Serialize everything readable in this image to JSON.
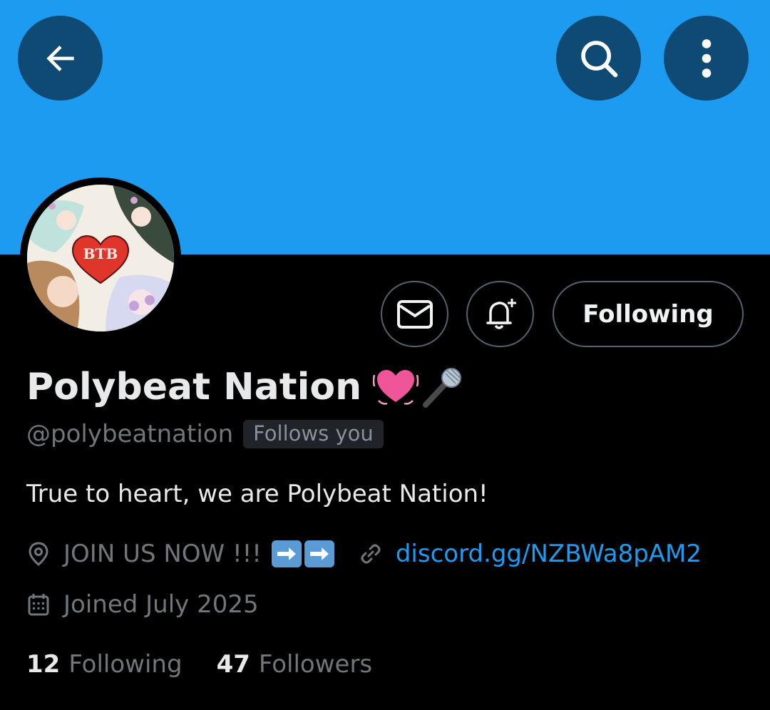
{
  "header": {
    "back_icon": "arrow-left-icon",
    "search_icon": "search-icon",
    "more_icon": "more-vertical-icon",
    "banner_color": "#1d9bf0"
  },
  "profile": {
    "avatar_text": "BTB",
    "display_name": "Polybeat Nation",
    "name_emoji": [
      "beating-heart",
      "microphone"
    ],
    "handle": "@polybeatnation",
    "follows_badge": "Follows you",
    "bio": "True to heart, we are Polybeat Nation!",
    "location": "JOIN US NOW !!!",
    "location_emoji": [
      "right-arrow",
      "right-arrow"
    ],
    "website": "discord.gg/NZBWa8pAM2",
    "joined": "Joined July 2025"
  },
  "actions": {
    "message_icon": "envelope-icon",
    "notify_icon": "bell-plus-icon",
    "follow_label": "Following"
  },
  "stats": {
    "following_count": "12",
    "following_label": "Following",
    "followers_count": "47",
    "followers_label": "Followers"
  }
}
